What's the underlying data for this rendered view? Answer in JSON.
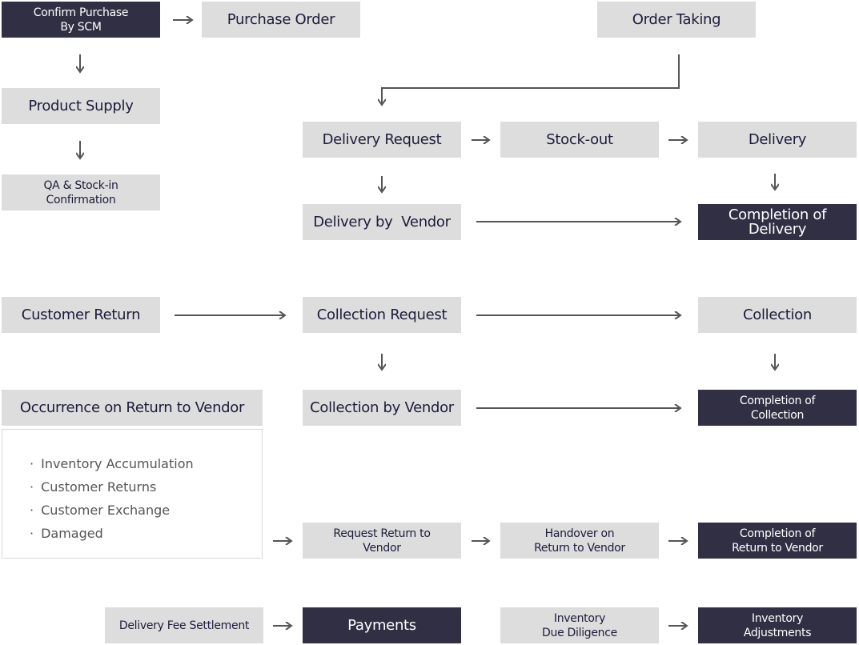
{
  "colors": {
    "dark_box": "#302f44",
    "light_box": "#dddddd",
    "text": "#1c1c3c",
    "arrow": "#555555"
  },
  "nodes": {
    "confirm_purchase": "Confirm Purchase\nBy SCM",
    "purchase_order": "Purchase Order",
    "order_taking": "Order Taking",
    "product_supply": "Product Supply",
    "qa_stock_in": "QA & Stock-in\nConfirmation",
    "delivery_request": "Delivery Request",
    "stock_out": "Stock-out",
    "delivery": "Delivery",
    "delivery_by_vendor": "Delivery by  Vendor",
    "completion_of_delivery": "Completion of Delivery",
    "customer_return": "Customer Return",
    "collection_request": "Collection Request",
    "collection": "Collection",
    "occurrence_rtv": "Occurrence on Return to Vendor",
    "collection_by_vendor": "Collection by Vendor",
    "completion_of_collection": "Completion of\nCollection",
    "request_rtv": "Request Return to\nVendor",
    "handover_rtv": "Handover on\nReturn to Vendor",
    "completion_rtv": "Completion of\nReturn to Vendor",
    "delivery_fee_settlement": "Delivery Fee Settlement",
    "payments": "Payments",
    "inventory_due_diligence": "Inventory\nDue Diligence",
    "inventory_adjustments": "Inventory\nAdjustments"
  },
  "rtv_reasons": {
    "bullet": "·",
    "items": [
      "Inventory Accumulation",
      "Customer Returns",
      "Customer Exchange",
      "Damaged"
    ]
  }
}
